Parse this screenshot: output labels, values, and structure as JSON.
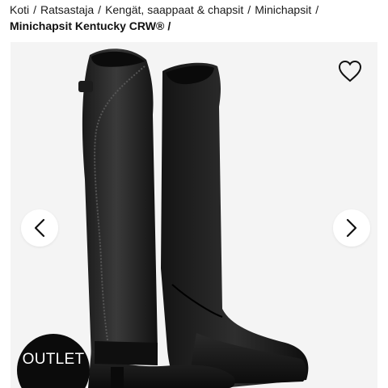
{
  "breadcrumb": {
    "items": [
      "Koti",
      "Ratsastaja",
      "Kengät, saappaat & chapsit",
      "Minichapsit"
    ],
    "separator": "/",
    "current": "Minichapsit Kentucky CRW®"
  },
  "gallery": {
    "badge": "OUTLET",
    "wishlist_icon": "heart-outline-icon",
    "prev_icon": "chevron-left-icon",
    "next_icon": "chevron-right-icon",
    "background": "#f4f4f4",
    "badge_color": "#0b0b0b"
  }
}
